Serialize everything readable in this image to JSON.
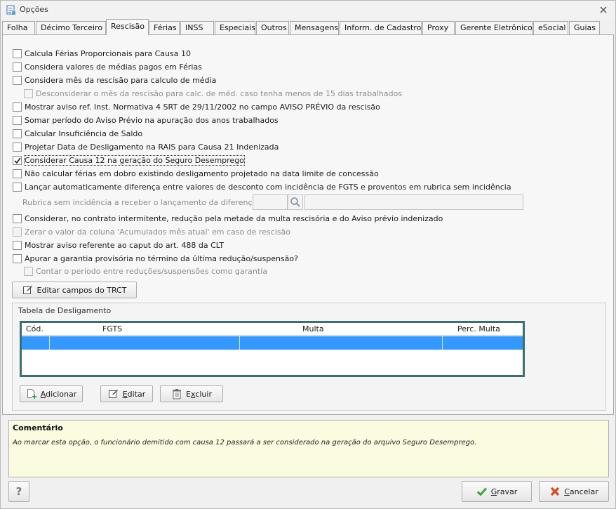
{
  "window": {
    "title": "Opções"
  },
  "tabs": [
    {
      "label": "Folha"
    },
    {
      "label": "Décimo Terceiro"
    },
    {
      "label": "Rescisão"
    },
    {
      "label": "Férias"
    },
    {
      "label": "INSS"
    },
    {
      "label": "Especiais"
    },
    {
      "label": "Outros"
    },
    {
      "label": "Mensagens"
    },
    {
      "label": "Inform. de Cadastro"
    },
    {
      "label": "Proxy"
    },
    {
      "label": "Gerente Eletrônico"
    },
    {
      "label": "eSocial"
    },
    {
      "label": "Guias"
    }
  ],
  "active_tab": "Rescisão",
  "options": [
    {
      "label": "Calcula Férias Proporcionais para Causa 10",
      "checked": false,
      "enabled": true
    },
    {
      "label": "Considera valores de médias pagos em Férias",
      "checked": false,
      "enabled": true
    },
    {
      "label": "Considera mês da rescisão para calculo de média",
      "checked": false,
      "enabled": true
    },
    {
      "label": "Desconsiderar o mês da rescisão para calc. de méd. caso tenha menos de 15 dias trabalhados",
      "checked": false,
      "enabled": false
    },
    {
      "label": "Mostrar aviso ref. Inst. Normativa 4 SRT de 29/11/2002 no campo AVISO PRÉVIO da rescisão",
      "checked": false,
      "enabled": true
    },
    {
      "label": "Somar período do Aviso Prévio na apuração dos anos trabalhados",
      "checked": false,
      "enabled": true
    },
    {
      "label": "Calcular Insuficiência de Saldo",
      "checked": false,
      "enabled": true
    },
    {
      "label": "Projetar Data de Desligamento na RAIS para Causa 21 Indenizada",
      "checked": false,
      "enabled": true
    },
    {
      "label": "Considerar Causa 12 na geração do Seguro Desemprego",
      "checked": true,
      "enabled": true
    },
    {
      "label": "Não calcular férias em dobro existindo desligamento projetado na data limite de concessão",
      "checked": false,
      "enabled": true
    },
    {
      "label": "Lançar automaticamente diferença entre valores de desconto com incidência de FGTS e proventos em rubrica sem incidência",
      "checked": false,
      "enabled": true
    },
    {
      "label": "Considerar, no contrato intermitente, redução pela metade da multa rescisória e do Aviso prévio indenizado",
      "checked": false,
      "enabled": true
    },
    {
      "label": "Zerar o valor da coluna 'Acumulados mês atual' em caso de rescisão",
      "checked": false,
      "enabled": false
    },
    {
      "label": "Mostrar aviso referente ao caput do art. 488 da CLT",
      "checked": false,
      "enabled": true
    },
    {
      "label": "Apurar a garantia provisória no término da última redução/suspensão?",
      "checked": false,
      "enabled": true
    },
    {
      "label": "Contar o período entre reduções/suspensões como garantia",
      "checked": false,
      "enabled": false
    }
  ],
  "rubrica": {
    "label": "Rubrica sem incidência a receber o lançamento da diferença:",
    "code": "",
    "description": ""
  },
  "edit_trct_button": "Editar campos do TRCT",
  "desligamento": {
    "title": "Tabela de Desligamento",
    "columns": [
      "Cód.",
      "FGTS",
      "Multa",
      "Perc. Multa"
    ],
    "rows": [
      [
        "",
        "",
        "",
        ""
      ]
    ]
  },
  "grid_buttons": {
    "add": "Adicionar",
    "edit": "Editar",
    "delete": "Excluir"
  },
  "comment": {
    "title": "Comentário",
    "text": "Ao marcar esta opção, o funcionário demitido com causa 12 passará a ser considerado na geração do arquivo Seguro Desemprego."
  },
  "footer": {
    "help": "?",
    "save": "Gravar",
    "cancel": "Cancelar"
  },
  "colors": {
    "selection": "#3399ff",
    "grid_border": "#3a6f6f",
    "comment_bg": "#fbfbe0",
    "save_check": "#3aa53a",
    "cancel_x": "#d9481c"
  }
}
